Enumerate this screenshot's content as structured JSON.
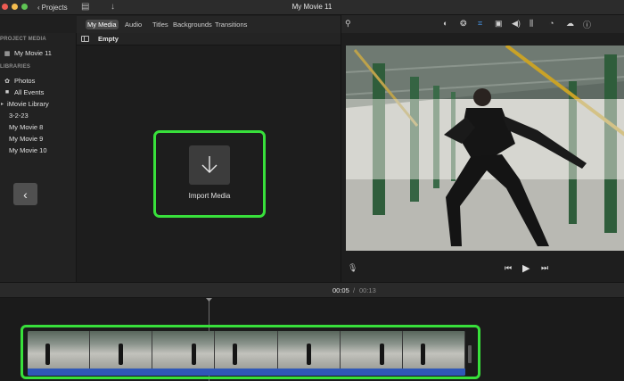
{
  "titlebar": {
    "projects_label": "Projects",
    "title": "My Movie 11"
  },
  "browser_tabs": [
    {
      "label": "My Media",
      "active": true
    },
    {
      "label": "Audio",
      "active": false
    },
    {
      "label": "Titles",
      "active": false
    },
    {
      "label": "Backgrounds",
      "active": false
    },
    {
      "label": "Transitions",
      "active": false
    }
  ],
  "sidebar": {
    "project_media_heading": "PROJECT MEDIA",
    "project_item": "My Movie 11",
    "libraries_heading": "LIBRARIES",
    "library_items": [
      "Photos",
      "All Events",
      "iMovie Library",
      "3-2-23",
      "My Movie 8",
      "My Movie 9",
      "My Movie 10"
    ]
  },
  "browser": {
    "filter_label": "Empty",
    "import_label": "Import Media"
  },
  "timeline": {
    "current_time": "00:05",
    "separator": "/",
    "total_time": "00:13"
  },
  "colors": {
    "highlight": "#38e03b",
    "audio_strip": "#2f58b8"
  }
}
